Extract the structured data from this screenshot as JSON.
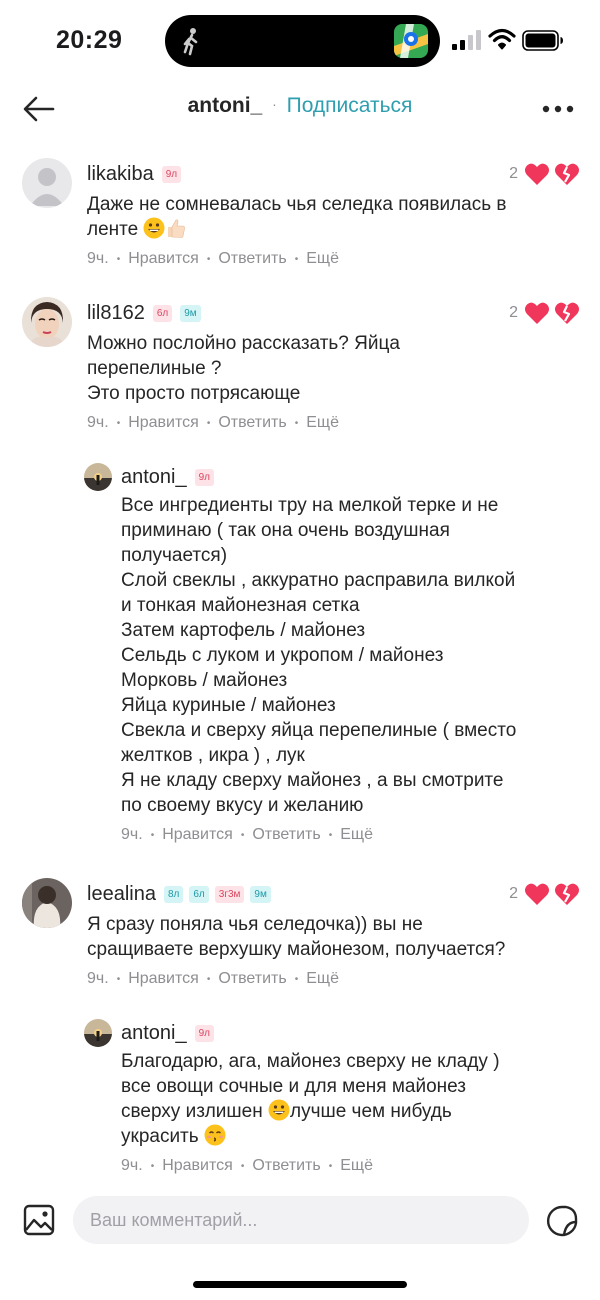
{
  "status": {
    "time": "20:29"
  },
  "header": {
    "username": "antoni_",
    "dot": "·",
    "follow_label": "Подписаться"
  },
  "comments": [
    {
      "user": "likakiba",
      "badges": [
        "9л"
      ],
      "text": "Даже не сомневалась чья селедка появилась в\nленте",
      "time": "9ч.",
      "like_label": "Нравится",
      "reply_label": "Ответить",
      "more_label": "Ещё",
      "likes": "2"
    },
    {
      "user": "lil8162",
      "badges": [
        "6л",
        "9м"
      ],
      "text": "Можно послойно рассказать? Яйца\nперепелиные ?\nЭто просто потрясающе",
      "time": "9ч.",
      "like_label": "Нравится",
      "reply_label": "Ответить",
      "more_label": "Ещё",
      "likes": "2"
    },
    {
      "user": "antoni_",
      "badges": [
        "9л"
      ],
      "text": "Все ингредиенты тру на мелкой терке и не\nприминаю ( так она очень воздушная\nполучается)\nСлой свеклы , аккуратно расправила вилкой\nи тонкая майонезная сетка\nЗатем картофель / майонез\nСельдь с луком и укропом / майонез\nМорковь / майонез\nЯйца куриные / майонез\nСвекла и сверху яйца перепелиные ( вместо\nжелтков , икра ) , лук\nЯ не кладу сверху майонез , а вы смотрите\nпо своему вкусу и желанию",
      "time": "9ч.",
      "like_label": "Нравится",
      "reply_label": "Ответить",
      "more_label": "Ещё"
    },
    {
      "user": "leealina",
      "badges": [
        "8л",
        "6л",
        "3г3м",
        "9м"
      ],
      "text": "Я сразу поняла чья селедочка)) вы не\nсращиваете верхушку майонезом, получается?",
      "time": "9ч.",
      "like_label": "Нравится",
      "reply_label": "Ответить",
      "more_label": "Ещё",
      "likes": "2"
    },
    {
      "user": "antoni_",
      "badges": [
        "9л"
      ],
      "text_lines": [
        "Благодарю, ага, майонез сверху не кладу )",
        "все овощи сочные и для меня майонез",
        "сверху излишен",
        "лучше чем нибудь",
        "украсить"
      ],
      "time": "9ч.",
      "like_label": "Нравится",
      "reply_label": "Ответить",
      "more_label": "Ещё"
    }
  ],
  "composer": {
    "placeholder": "Ваш комментарий..."
  },
  "icons": {
    "back": "arrow-left-icon",
    "more": "more-horizontal-icon",
    "like": "heart-icon",
    "dislike": "broken-heart-icon",
    "image": "image-icon",
    "sticker": "sticker-icon"
  },
  "colors": {
    "accent": "#2f9fb0",
    "heart": "#f0365a",
    "meta": "#8e8e93"
  }
}
